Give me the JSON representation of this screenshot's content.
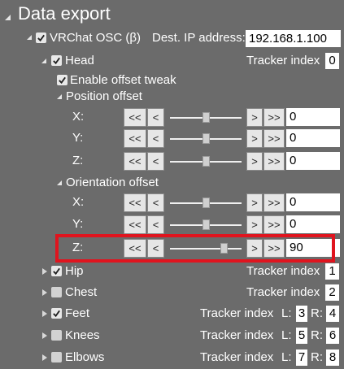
{
  "section": {
    "title": "Data export"
  },
  "osc": {
    "label": "VRChat OSC (β)",
    "checked": true,
    "ip_label": "Dest. IP address:",
    "ip_value": "192.168.1.100"
  },
  "head": {
    "label": "Head",
    "checked": true,
    "tracker_label": "Tracker index",
    "tracker_value": "0",
    "enable_offset_label": "Enable offset tweak",
    "enable_offset_checked": true,
    "position": {
      "label": "Position offset",
      "rows": [
        {
          "axis": "X:",
          "value": "0",
          "slider_fraction": 0.5
        },
        {
          "axis": "Y:",
          "value": "0",
          "slider_fraction": 0.5
        },
        {
          "axis": "Z:",
          "value": "0",
          "slider_fraction": 0.5
        }
      ]
    },
    "orientation": {
      "label": "Orientation offset",
      "rows": [
        {
          "axis": "X:",
          "value": "0",
          "slider_fraction": 0.5
        },
        {
          "axis": "Y:",
          "value": "0",
          "slider_fraction": 0.5
        },
        {
          "axis": "Z:",
          "value": "90",
          "slider_fraction": 0.75,
          "highlighted": true
        }
      ]
    }
  },
  "buttons": {
    "fast_dec": "<<",
    "dec": "<",
    "inc": ">",
    "fast_inc": ">>"
  },
  "trackers": [
    {
      "label": "Hip",
      "checked": true,
      "tracker_label": "Tracker index",
      "value": "1"
    },
    {
      "label": "Chest",
      "checked": false,
      "tracker_label": "Tracker index",
      "value": "2"
    },
    {
      "label": "Feet",
      "checked": true,
      "tracker_label": "Tracker index",
      "l_label": "L:",
      "l_value": "3",
      "r_label": "R:",
      "r_value": "4"
    },
    {
      "label": "Knees",
      "checked": false,
      "tracker_label": "Tracker index",
      "l_label": "L:",
      "l_value": "5",
      "r_label": "R:",
      "r_value": "6"
    },
    {
      "label": "Elbows",
      "checked": false,
      "tracker_label": "Tracker index",
      "l_label": "L:",
      "l_value": "7",
      "r_label": "R:",
      "r_value": "8"
    }
  ],
  "colors": {
    "background": "#6b6b6b",
    "highlight_border": "#e0141e"
  }
}
